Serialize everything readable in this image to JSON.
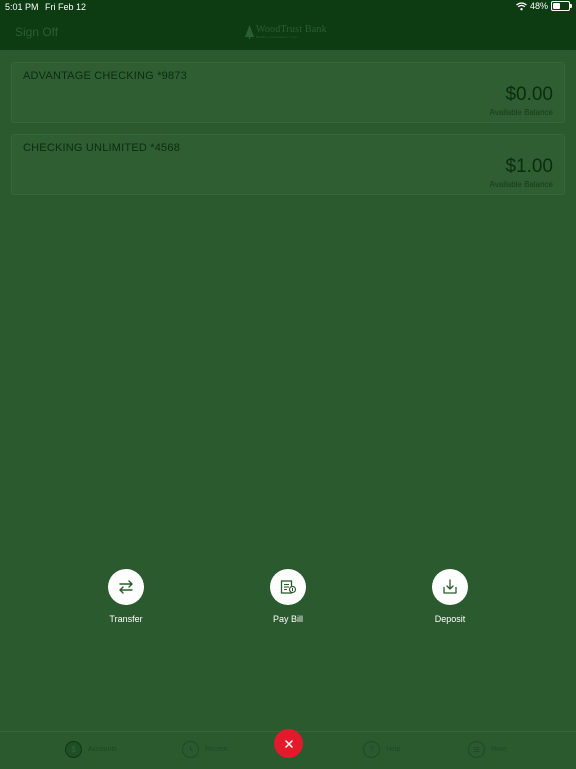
{
  "status_bar": {
    "time": "5:01 PM",
    "date": "Fri Feb 12",
    "battery": "48%"
  },
  "header": {
    "sign_off": "Sign Off",
    "logo_name": "WoodTrust Bank",
    "logo_tagline": "Banking | Investments | Trust"
  },
  "accounts": [
    {
      "name": "ADVANTAGE CHECKING *9873",
      "balance": "$0.00",
      "balance_label": "Available Balance"
    },
    {
      "name": "CHECKING UNLIMITED *4568",
      "balance": "$1.00",
      "balance_label": "Available Balance"
    }
  ],
  "actions": {
    "transfer": "Transfer",
    "pay_bill": "Pay Bill",
    "deposit": "Deposit"
  },
  "tabbar": {
    "accounts": "Accounts",
    "recent": "Recent",
    "help": "Help",
    "more": "More",
    "accounts_icon_glyph": "$",
    "help_icon_glyph": "?"
  },
  "colors": {
    "background": "#2b5a2e",
    "header": "#0d3b12",
    "fab": "#e21a2c",
    "action_circle": "#ffffff"
  },
  "icons": {
    "wifi": "wifi-icon",
    "battery": "battery-icon",
    "transfer": "transfer-arrows-icon",
    "pay_bill": "bill-icon",
    "deposit": "download-tray-icon",
    "accounts": "dollar-icon",
    "recent": "clock-icon",
    "help": "question-icon",
    "more": "menu-lines-icon",
    "close": "close-icon"
  }
}
